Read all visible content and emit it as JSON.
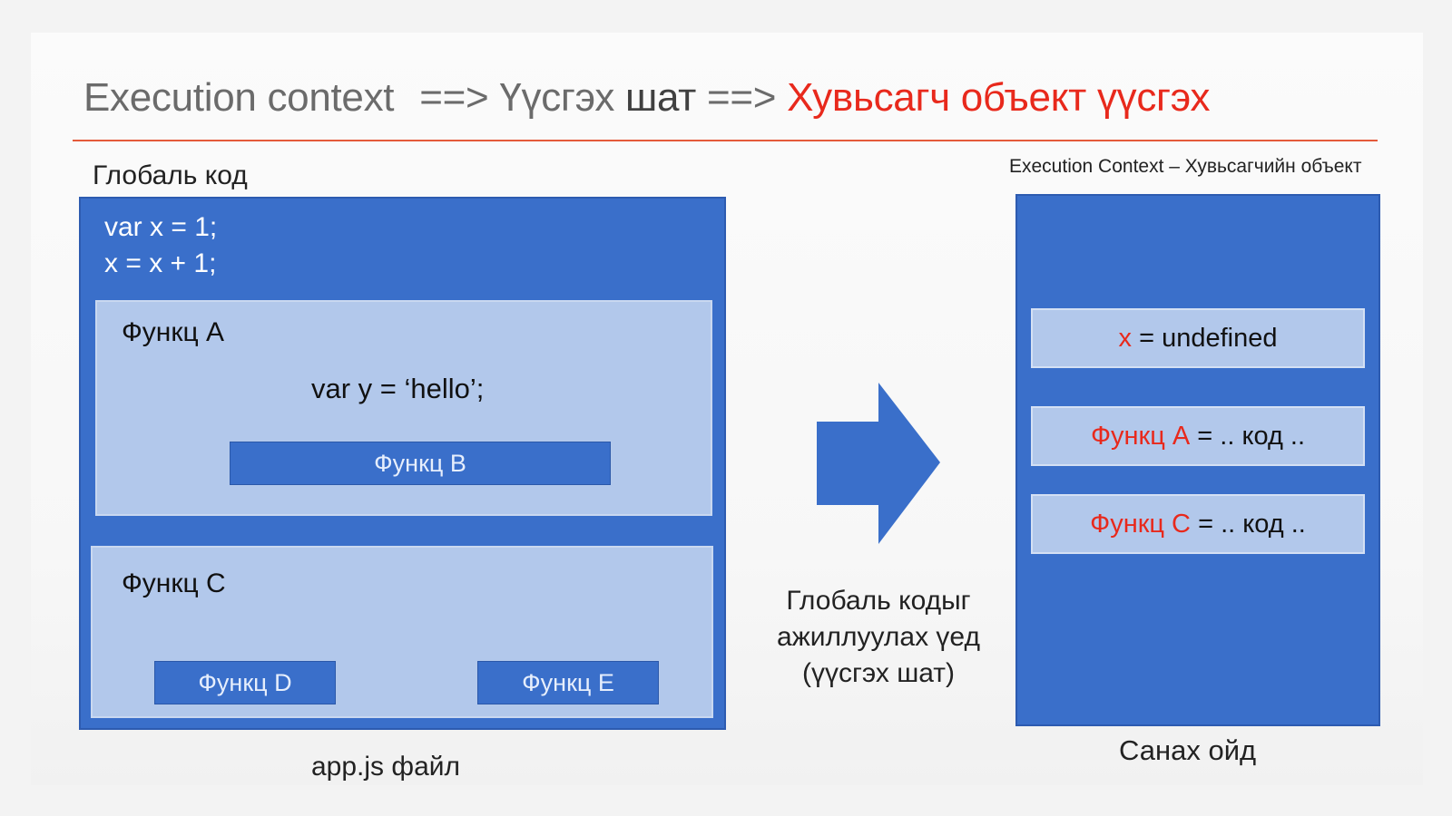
{
  "title": {
    "part1": "Execution context",
    "arrow1": "==>",
    "part2a": "Үүсгэх",
    "part2b": "шат",
    "arrow2": "==>",
    "part3": "Хувьсагч объект үүсгэх"
  },
  "left": {
    "heading": "Глобаль код",
    "code_lines": [
      "var x = 1;",
      "x = x + 1;"
    ],
    "func_a": {
      "label": "Функц A",
      "code": "var y = ‘hello’;",
      "nested": "Функц B"
    },
    "func_c": {
      "label": "Функц C",
      "nested": [
        "Функц D",
        "Функц E"
      ]
    },
    "file_label": "app.js файл"
  },
  "middle": {
    "caption_lines": [
      "Глобаль кодыг",
      "ажиллуулах үед",
      "(үүсгэх шат)"
    ]
  },
  "right": {
    "heading": "Execution Context – Хувьсагчийн объект",
    "entries": [
      {
        "name": "x",
        "rest": " = undefined"
      },
      {
        "name": "Функц A",
        "rest": " = .. код .."
      },
      {
        "name": "Функц C",
        "rest": " = .. код .."
      }
    ],
    "memory_label": "Санах ойд"
  },
  "colors": {
    "accent_red": "#e8291c",
    "box_blue": "#3a6fca",
    "light_blue": "#b2c8eb",
    "rule": "#e45a3a"
  },
  "icons": {
    "arrow": "right-arrow-icon"
  }
}
